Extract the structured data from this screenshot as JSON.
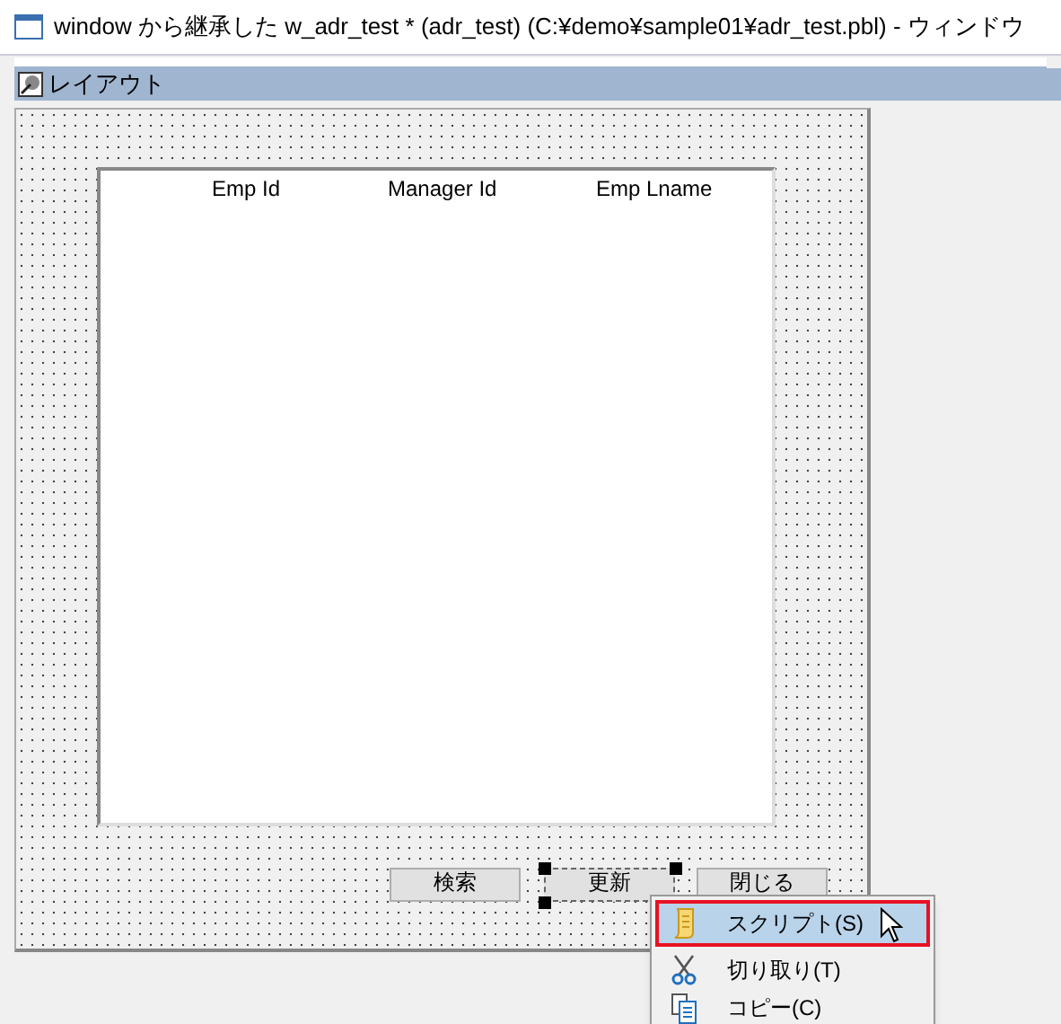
{
  "window": {
    "title": "window から継承した w_adr_test * (adr_test) (C:¥demo¥sample01¥adr_test.pbl) - ウィンドウ"
  },
  "panel": {
    "title": "レイアウト"
  },
  "datawindow": {
    "columns": [
      "Emp Id",
      "Manager Id",
      "Emp Lname"
    ]
  },
  "buttons": [
    {
      "label": "検索",
      "selected": false
    },
    {
      "label": "更新",
      "selected": true
    },
    {
      "label": "閉じる",
      "selected": false
    }
  ],
  "context_menu": [
    {
      "label": "スクリプト(S)",
      "selected": true
    },
    {
      "label": "切り取り(T)",
      "selected": false
    },
    {
      "label": "コピー(C)",
      "selected": false
    }
  ]
}
